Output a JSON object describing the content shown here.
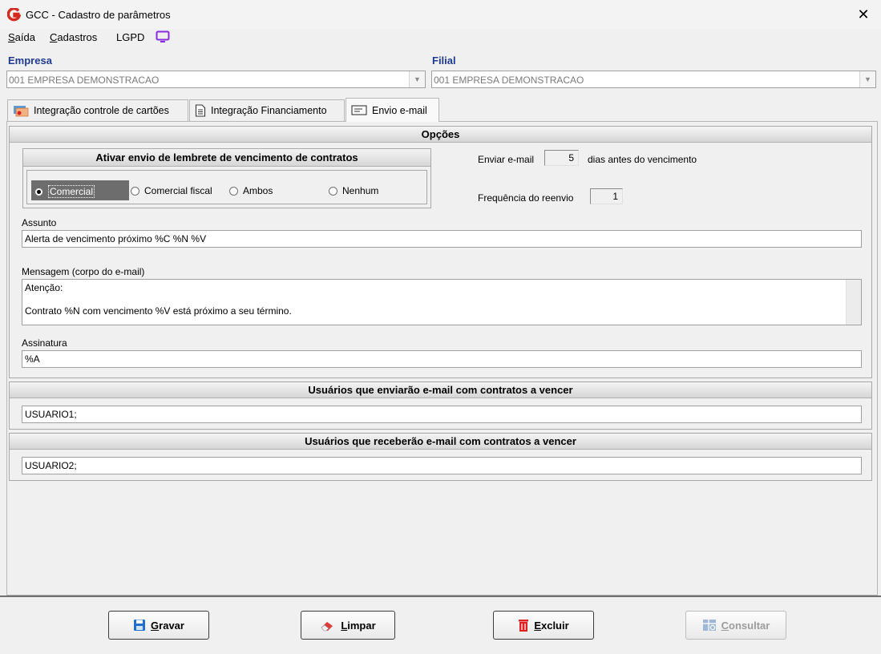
{
  "window": {
    "title": "GCC - Cadastro de parâmetros"
  },
  "menu": {
    "items": [
      {
        "id": "saida",
        "label": "Saída"
      },
      {
        "id": "cadastros",
        "label": "Cadastros"
      },
      {
        "id": "lgpd",
        "label": "LGPD"
      }
    ]
  },
  "empresa": {
    "label": "Empresa",
    "value": "001 EMPRESA DEMONSTRACAO"
  },
  "filial": {
    "label": "Filial",
    "value": "001 EMPRESA DEMONSTRACAO"
  },
  "tabs": [
    {
      "label": "Integração controle de cartões",
      "icon": "cards-icon",
      "active": false
    },
    {
      "label": "Integração Financiamento",
      "icon": "document-icon",
      "active": false
    },
    {
      "label": "Envio e-mail",
      "icon": "envelope-icon",
      "active": true
    }
  ],
  "opcoes": {
    "title": "Opções",
    "reminder_group": {
      "title": "Ativar envio de lembrete de vencimento de contratos",
      "options": [
        {
          "label": "Comercial",
          "selected": true
        },
        {
          "label": "Comercial fiscal",
          "selected": false
        },
        {
          "label": "Ambos",
          "selected": false
        },
        {
          "label": "Nenhum",
          "selected": false
        }
      ]
    },
    "send_email_label": "Enviar e-mail",
    "send_email_days": "5",
    "send_email_suffix": "dias antes do vencimento",
    "frequency_label": "Frequência do reenvio",
    "frequency_value": "1",
    "subject_label": "Assunto",
    "subject_value": "Alerta de vencimento próximo %C %N %V",
    "message_label": "Mensagem (corpo do e-mail)",
    "message_line1": "Atenção:",
    "message_line2": "Contrato %N com vencimento  %V está próximo a seu término.",
    "signature_label": "Assinatura",
    "signature_value": "%A"
  },
  "senders": {
    "title": "Usuários que enviarão e-mail com contratos a vencer",
    "value": "USUARIO1;"
  },
  "receivers": {
    "title": "Usuários que receberão e-mail com contratos a vencer",
    "value": "USUARIO2;"
  },
  "buttons": {
    "save": "Gravar",
    "clear": "Limpar",
    "delete": "Excluir",
    "query": "Consultar"
  },
  "colors": {
    "caption_blue": "#1f3a93",
    "logo_red": "#d42a1f",
    "lgpd_purple": "#8a2be2",
    "selected_radio_bg": "#6d6d6d"
  }
}
